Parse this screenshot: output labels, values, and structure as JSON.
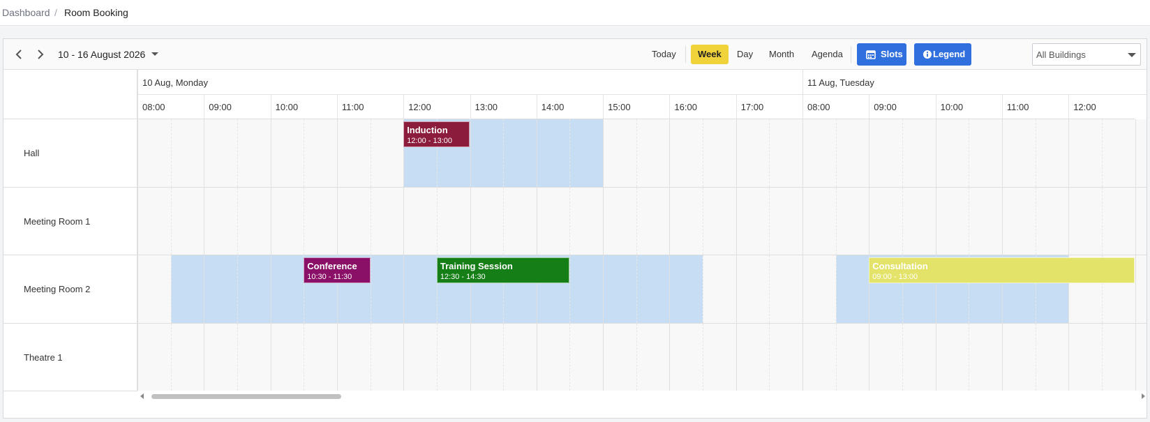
{
  "breadcrumb": {
    "parent": "Dashboard",
    "separator": "/",
    "current": "Room Booking"
  },
  "toolbar": {
    "date_range": "10 - 16 August 2026",
    "views": {
      "today": "Today",
      "week": "Week",
      "day": "Day",
      "month": "Month",
      "agenda": "Agenda"
    },
    "active_view": "Week",
    "slots_label": "Slots",
    "legend_label": "Legend",
    "building_filter": "All Buildings"
  },
  "days": [
    {
      "label": "10 Aug, Monday",
      "hours": [
        "08:00",
        "09:00",
        "10:00",
        "11:00",
        "12:00",
        "13:00",
        "14:00",
        "15:00",
        "16:00",
        "17:00"
      ]
    },
    {
      "label": "11 Aug, Tuesday",
      "hours": [
        "08:00",
        "09:00",
        "10:00",
        "11:00",
        "12:00"
      ]
    }
  ],
  "rooms": [
    "Hall",
    "Meeting Room 1",
    "Meeting Room 2",
    "Theatre 1"
  ],
  "events": [
    {
      "room": 0,
      "title": "Induction",
      "time": "12:00 - 13:00",
      "color": "#8c1c3b"
    },
    {
      "room": 2,
      "title": "Conference",
      "time": "10:30 - 11:30",
      "color": "#8a0f66"
    },
    {
      "room": 2,
      "title": "Training Session",
      "time": "12:30 - 14:30",
      "color": "#167e16"
    },
    {
      "room": 2,
      "title": "Consultation",
      "time": "09:00 - 13:00",
      "color": "#e3e36a"
    }
  ],
  "colors": {
    "accent": "#2f6fde",
    "active_view": "#f0d23a",
    "slot": "#c6ddf3"
  }
}
